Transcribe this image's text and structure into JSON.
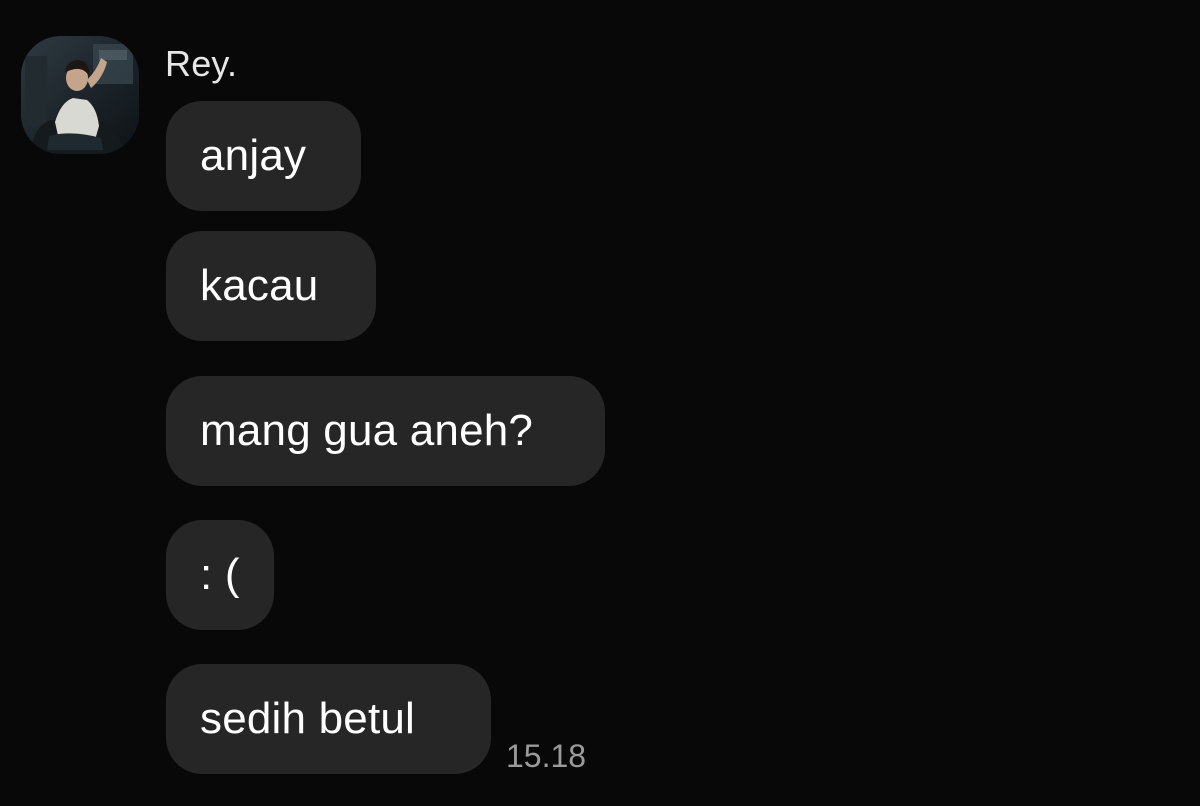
{
  "conversation": {
    "sender": {
      "name": "Rey.",
      "avatar_icon": "profile-photo"
    },
    "messages": [
      {
        "text": "anjay"
      },
      {
        "text": "kacau"
      },
      {
        "text": "mang gua aneh?"
      },
      {
        "text": ": ("
      },
      {
        "text": "sedih betul"
      }
    ],
    "last_timestamp": "15.18"
  },
  "colors": {
    "background": "#080808",
    "bubble": "#262626",
    "text": "#ffffff",
    "timestamp": "#9a9a9a"
  }
}
